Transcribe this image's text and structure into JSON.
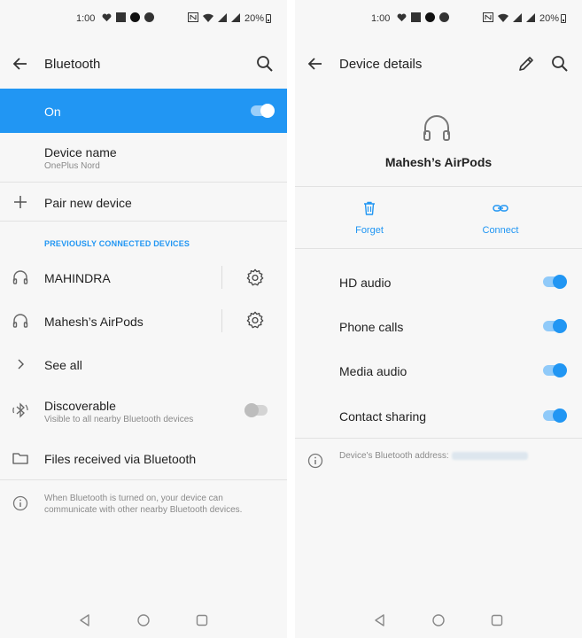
{
  "status": {
    "time": "1:00",
    "battery": "20%"
  },
  "left": {
    "appbar": {
      "title": "Bluetooth",
      "back_icon": "arrow-back-icon",
      "search_icon": "search-icon"
    },
    "bluetooth_switch": {
      "label": "On",
      "state": "on"
    },
    "device_name": {
      "label": "Device name",
      "value": "OnePlus Nord"
    },
    "pair_new_device": {
      "label": "Pair new device",
      "icon": "plus-icon"
    },
    "section_label": "PREVIOUSLY CONNECTED DEVICES",
    "devices": [
      {
        "name": "MAHINDRA",
        "icon": "headphones-icon"
      },
      {
        "name": "Mahesh’s AirPods",
        "icon": "headphones-icon"
      }
    ],
    "see_all": {
      "label": "See all",
      "icon": "chevron-right-icon"
    },
    "discoverable": {
      "label": "Discoverable",
      "sub": "Visible to all nearby Bluetooth devices",
      "state": "off",
      "icon": "bluetooth-searching-icon"
    },
    "files_received": {
      "label": "Files received via Bluetooth",
      "icon": "folder-icon"
    },
    "footer": {
      "text": "When Bluetooth is turned on, your device can communicate with other nearby Bluetooth devices.",
      "icon": "info-icon"
    }
  },
  "right": {
    "appbar": {
      "title": "Device details",
      "back_icon": "arrow-back-icon",
      "edit_icon": "pencil-icon",
      "search_icon": "search-icon"
    },
    "device": {
      "name": "Mahesh’s AirPods",
      "icon": "headphones-icon"
    },
    "actions": [
      {
        "label": "Forget",
        "icon": "trash-icon"
      },
      {
        "label": "Connect",
        "icon": "link-icon"
      }
    ],
    "settings": [
      {
        "label": "HD audio",
        "state": "on"
      },
      {
        "label": "Phone calls",
        "state": "on"
      },
      {
        "label": "Media audio",
        "state": "on"
      },
      {
        "label": "Contact sharing",
        "state": "on"
      }
    ],
    "address": {
      "label": "Device's Bluetooth address:",
      "icon": "info-icon"
    }
  },
  "colors": {
    "accent": "#2196f3",
    "background": "#f7f7f7",
    "divider": "#e2e2e2",
    "secondary_text": "#8a8a8a"
  }
}
